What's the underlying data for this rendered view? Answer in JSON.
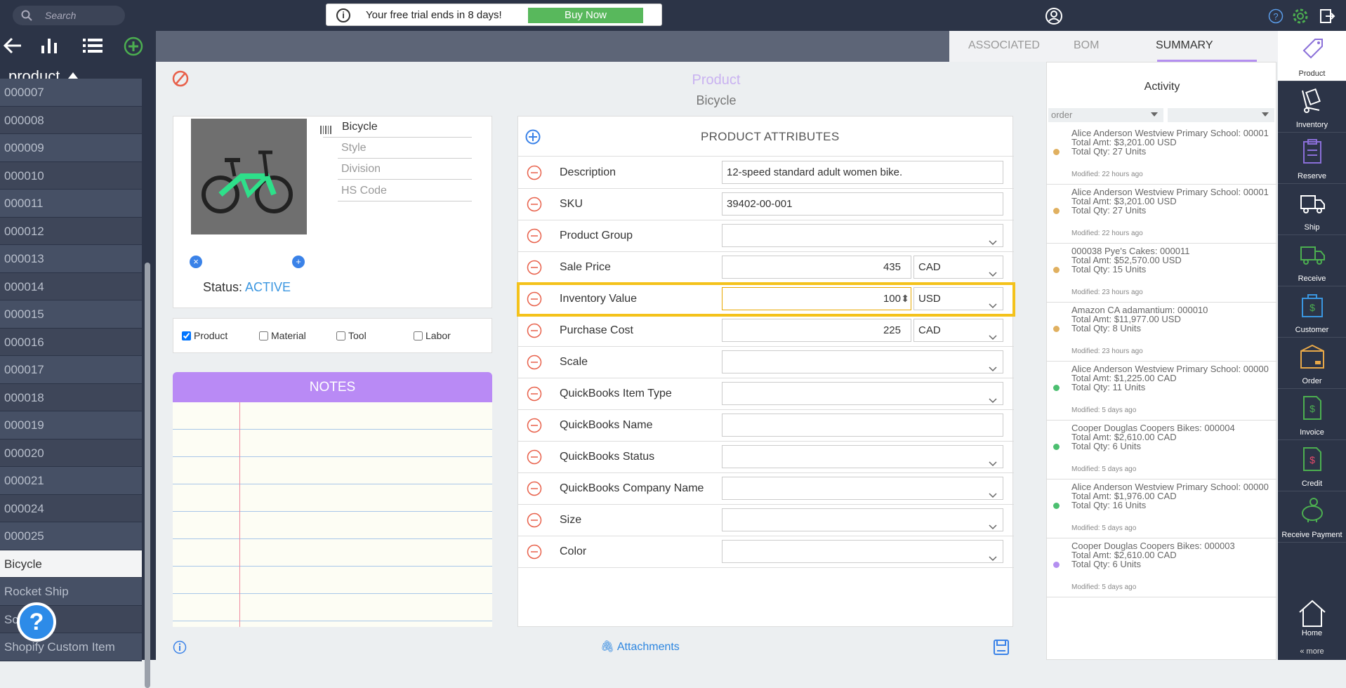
{
  "topbar": {
    "search_placeholder": "Search",
    "trial_message": "Your free trial ends in 8 days!",
    "buy_label": "Buy Now"
  },
  "leftnav": {
    "heading": "product",
    "items": [
      "000007",
      "000008",
      "000009",
      "000010",
      "000011",
      "000012",
      "000013",
      "000014",
      "000015",
      "000016",
      "000017",
      "000018",
      "000019",
      "000020",
      "000021",
      "000024",
      "000025",
      "Bicycle",
      "Rocket Ship",
      "Sc...g",
      "Shopify Custom Item"
    ],
    "active": "Bicycle"
  },
  "tabs": {
    "associated": "ASSOCIATED",
    "bom": "BOM",
    "summary": "SUMMARY"
  },
  "product": {
    "heading": "Product",
    "name": "Bicycle",
    "status_label": "Status:",
    "status_value": "ACTIVE",
    "fields": {
      "name": "Bicycle",
      "style": "Style",
      "division": "Division",
      "hs_code": "HS Code"
    },
    "types": [
      {
        "label": "Product",
        "checked": true
      },
      {
        "label": "Material",
        "checked": false
      },
      {
        "label": "Tool",
        "checked": false
      },
      {
        "label": "Labor",
        "checked": false
      }
    ],
    "notes_title": "NOTES"
  },
  "attributes": {
    "title": "PRODUCT ATTRIBUTES",
    "rows": [
      {
        "label": "Description",
        "value": "12-speed standard adult women bike."
      },
      {
        "label": "SKU",
        "value": "39402-00-001"
      },
      {
        "label": "Product Group",
        "value": ""
      },
      {
        "label": "Sale Price",
        "value": "435",
        "currency": "CAD"
      },
      {
        "label": "Inventory Value",
        "value": "100",
        "currency": "USD"
      },
      {
        "label": "Purchase Cost",
        "value": "225",
        "currency": "CAD"
      },
      {
        "label": "Scale",
        "value": ""
      },
      {
        "label": "QuickBooks Item Type",
        "value": ""
      },
      {
        "label": "QuickBooks Name",
        "value": ""
      },
      {
        "label": "QuickBooks Status",
        "value": ""
      },
      {
        "label": "QuickBooks Company Name",
        "value": ""
      },
      {
        "label": "Size",
        "value": ""
      },
      {
        "label": "Color",
        "value": ""
      }
    ]
  },
  "footer": {
    "attachments": "Attachments"
  },
  "activity": {
    "title": "Activity",
    "filter": "order",
    "items": [
      {
        "title": "Alice Anderson Westview Primary School: 00001",
        "amt": "Total Amt: $3,201.00 USD",
        "qty": "Total Qty: 27 Units",
        "modified": "Modified: 22 hours  ago",
        "color": "#e0b060"
      },
      {
        "title": "Alice Anderson Westview Primary School: 00001",
        "amt": "Total Amt: $3,201.00 USD",
        "qty": "Total Qty: 27 Units",
        "modified": "Modified: 22 hours  ago",
        "color": "#e0b060"
      },
      {
        "title": "000038 Pye's Cakes: 000011",
        "amt": "Total Amt: $52,570.00 USD",
        "qty": "Total Qty: 15 Units",
        "modified": "Modified: 23 hours  ago",
        "color": "#e0b060"
      },
      {
        "title": "Amazon CA adamantium: 000010",
        "amt": "Total Amt: $11,977.00 USD",
        "qty": "Total Qty: 8 Units",
        "modified": "Modified: 23 hours  ago",
        "color": "#e0b060"
      },
      {
        "title": "Alice Anderson Westview Primary School: 00000",
        "amt": "Total Amt: $1,225.00 CAD",
        "qty": "Total Qty: 11 Units",
        "modified": "Modified: 5 days  ago",
        "color": "#4cbf70"
      },
      {
        "title": "Cooper Douglas Coopers Bikes: 000004",
        "amt": "Total Amt: $2,610.00 CAD",
        "qty": "Total Qty: 6 Units",
        "modified": "Modified: 5 days  ago",
        "color": "#4cbf70"
      },
      {
        "title": "Alice Anderson Westview Primary School: 00000",
        "amt": "Total Amt: $1,976.00 CAD",
        "qty": "Total Qty: 16 Units",
        "modified": "Modified: 5 days  ago",
        "color": "#4cbf70"
      },
      {
        "title": "Cooper Douglas Coopers Bikes: 000003",
        "amt": "Total Amt: $2,610.00 CAD",
        "qty": "Total Qty: 6 Units",
        "modified": "Modified: 5 days  ago",
        "color": "#b48ff0"
      }
    ]
  },
  "rightnav": {
    "items": [
      "Product",
      "Inventory",
      "Reserve",
      "Ship",
      "Receive",
      "Customer",
      "Order",
      "Invoice",
      "Credit",
      "Receive Payment"
    ],
    "home": "Home",
    "more": "« more"
  }
}
